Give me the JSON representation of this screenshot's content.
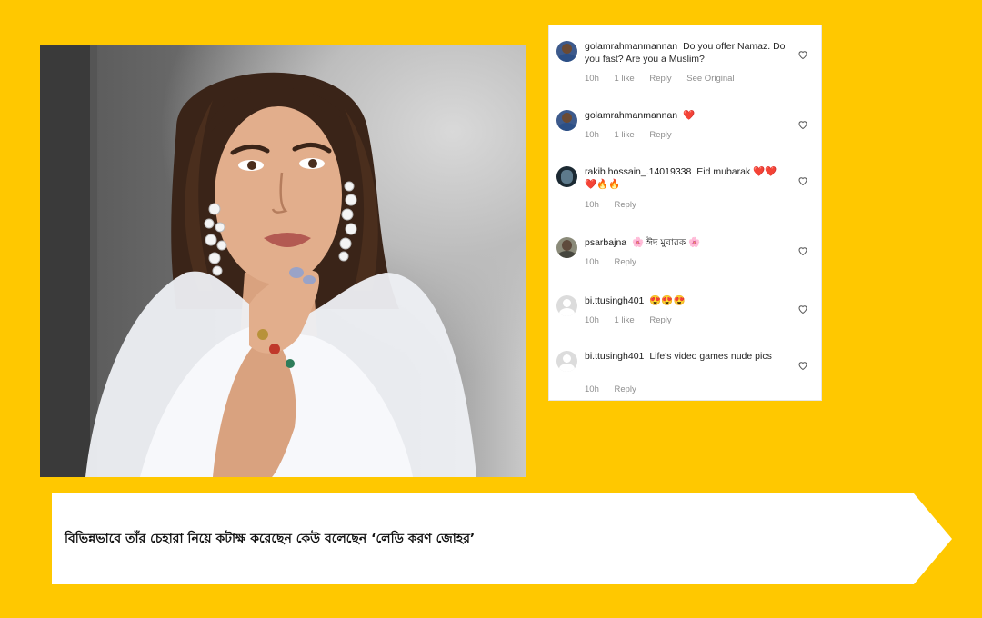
{
  "comments": [
    {
      "user": "golamrahmanmannan",
      "text": "Do you offer Namaz. Do you fast? Are you a Muslim?",
      "time": "10h",
      "likes": "1 like",
      "reply": "Reply",
      "extra": "See Original",
      "avatar": "man-avatar"
    },
    {
      "user": "golamrahmanmannan",
      "text": "❤️",
      "time": "10h",
      "likes": "1 like",
      "reply": "Reply",
      "extra": "",
      "avatar": "man-avatar"
    },
    {
      "user": "rakib.hossain_.14019338",
      "text": "Eid mubarak ❤️❤️❤️🔥🔥",
      "time": "10h",
      "likes": "",
      "reply": "Reply",
      "extra": "",
      "avatar": "dark-avatar"
    },
    {
      "user": "psarbajna",
      "text": "🌸 ঈদ মুবারক 🌸",
      "time": "10h",
      "likes": "",
      "reply": "Reply",
      "extra": "",
      "avatar": "photo-avatar"
    },
    {
      "user": "bi.ttusingh401",
      "text": "😍😍😍",
      "time": "10h",
      "likes": "1 like",
      "reply": "Reply",
      "extra": "",
      "avatar": "default-avatar"
    },
    {
      "user": "bi.ttusingh401",
      "text": "Life's video games nude pics",
      "time": "10h",
      "likes": "",
      "reply": "Reply",
      "extra": "",
      "avatar": "default-avatar"
    }
  ],
  "caption": "বিভিন্নভাবে তাঁর চেহারা নিয়ে কটাক্ষ করেছেন কেউ বলেছেন ‘লেডি করণ জোহর’",
  "colors": {
    "background": "#FFC800",
    "banner": "#FFFFFF",
    "heart_red": "#E0245E"
  }
}
